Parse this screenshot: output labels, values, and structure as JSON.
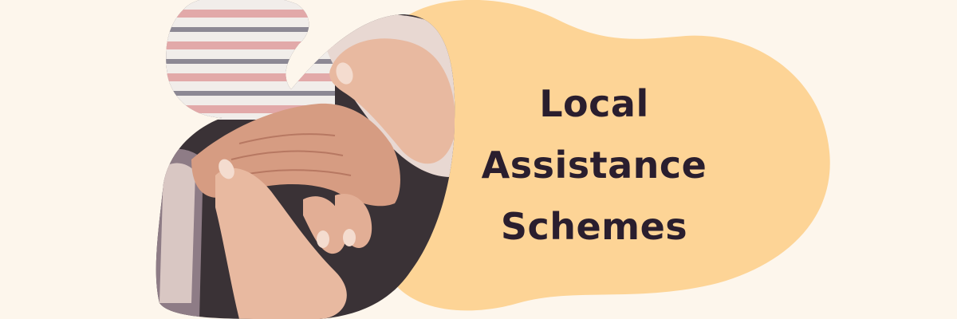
{
  "banner": {
    "title_lines": [
      "Local",
      "Assistance",
      "Schemes"
    ],
    "image_subject": "hands-holding-photo"
  },
  "colors": {
    "background": "#FDF6EC",
    "blob": "#FDD496",
    "title_text": "#2A1E2E",
    "skin_light": "#E8B9A0",
    "skin_mid": "#D69C82",
    "skin_dark": "#B77862",
    "photo_shadow": "#3A3236",
    "sleeve": "#D9C7C3",
    "stripe_pink": "#E2A9A9",
    "stripe_grey": "#8C8894",
    "stripe_white": "#F1EDEA"
  }
}
